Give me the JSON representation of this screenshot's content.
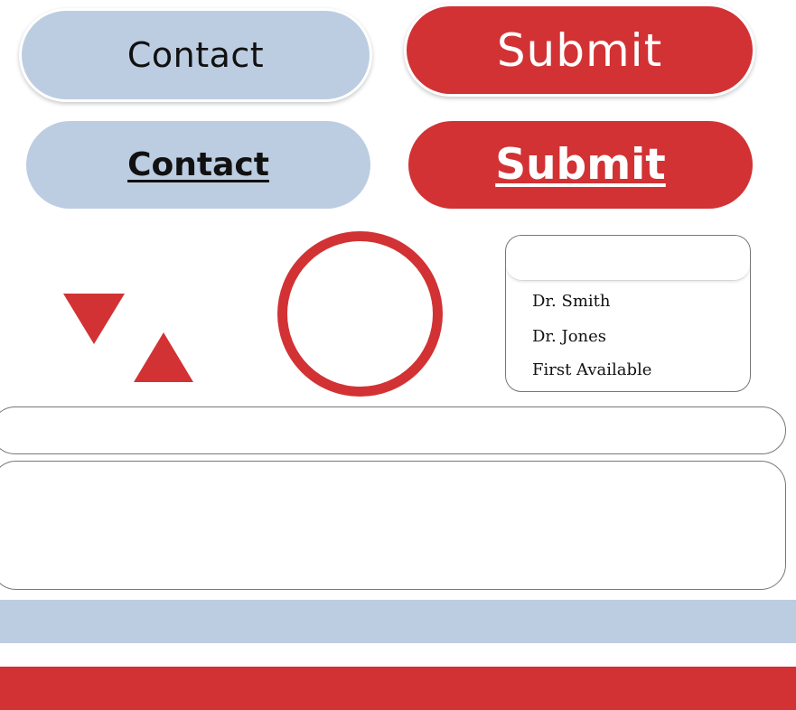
{
  "colors": {
    "primary_red": "#d23234",
    "light_blue": "#bccde2",
    "border_gray": "#777777"
  },
  "buttons": {
    "contact_raised": "Contact",
    "submit_raised": "Submit",
    "contact_flat": "Contact",
    "submit_flat": "Submit"
  },
  "dropdown": {
    "selected": "",
    "options": [
      "Dr. Smith",
      "Dr. Jones",
      "First Available"
    ]
  },
  "icons": {
    "down": "triangle-down-icon",
    "up": "triangle-up-icon",
    "ring": "circle-outline-icon"
  },
  "inputs": {
    "text_field_value": "",
    "text_area_value": ""
  }
}
